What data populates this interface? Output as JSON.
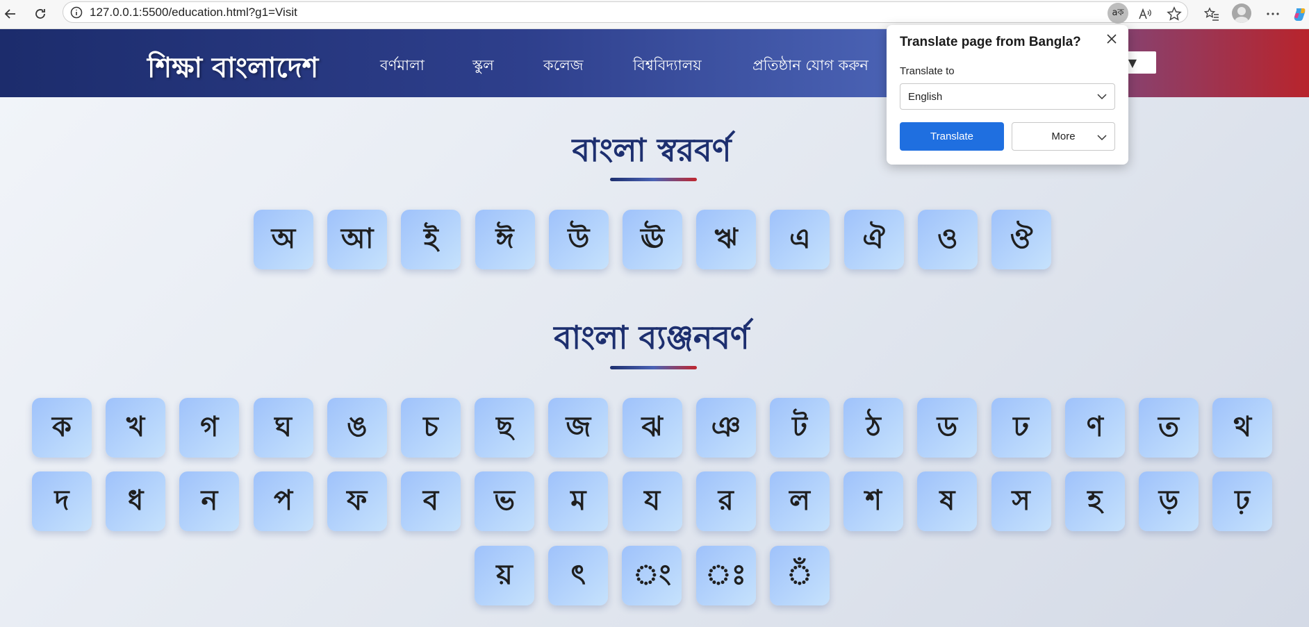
{
  "browser": {
    "url": "127.0.0.1:5500/education.html?g1=Visit",
    "translate_chip": "aক"
  },
  "site": {
    "logo": "শিক্ষা বাংলাদেশ",
    "nav": [
      "বর্ণমালা",
      "স্কুল",
      "কলেজ",
      "বিশ্ববিদ্যালয়",
      "প্রতিষ্ঠান যোগ করুন"
    ],
    "select_arrow": "▼"
  },
  "vowels": {
    "title": "বাংলা স্বরবর্ণ",
    "letters": [
      "অ",
      "আ",
      "ই",
      "ঈ",
      "উ",
      "ঊ",
      "ঋ",
      "এ",
      "ঐ",
      "ও",
      "ঔ"
    ]
  },
  "consonants": {
    "title": "বাংলা ব্যঞ্জনবর্ণ",
    "letters": [
      "ক",
      "খ",
      "গ",
      "ঘ",
      "ঙ",
      "চ",
      "ছ",
      "জ",
      "ঝ",
      "ঞ",
      "ট",
      "ঠ",
      "ড",
      "ঢ",
      "ণ",
      "ত",
      "থ",
      "দ",
      "ধ",
      "ন",
      "প",
      "ফ",
      "ব",
      "ভ",
      "ম",
      "য",
      "র",
      "ল",
      "শ",
      "ষ",
      "স",
      "হ",
      "ড়",
      "ঢ়",
      "য়",
      "ৎ",
      "ং",
      "ঃ",
      "ঁ"
    ]
  },
  "translate_popup": {
    "title": "Translate page from Bangla?",
    "label": "Translate to",
    "selected_language": "English",
    "translate_button": "Translate",
    "more_button": "More"
  },
  "colors": {
    "accent": "#1f6fe0",
    "title": "#1d2f6f",
    "header_start": "#1c2c6c",
    "header_end": "#b8242c"
  }
}
